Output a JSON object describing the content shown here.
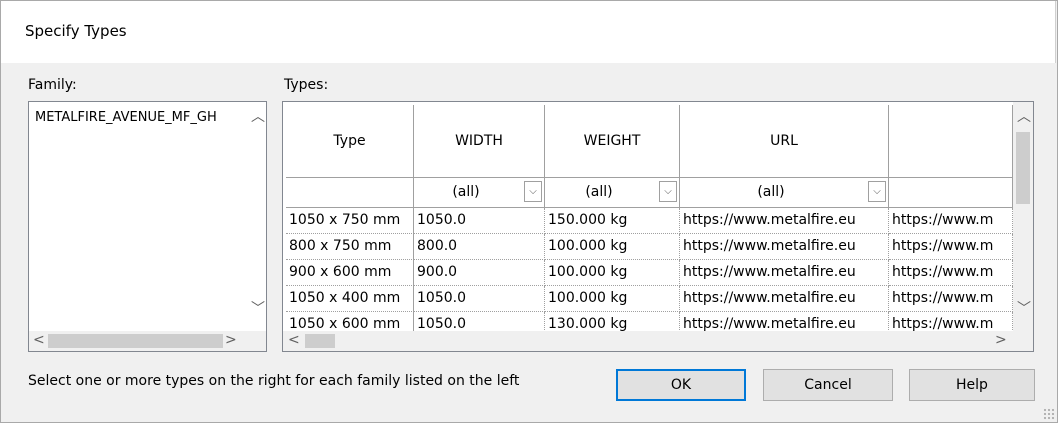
{
  "dialog": {
    "title": "Specify Types",
    "family_label": "Family:",
    "types_label": "Types:",
    "hint": "Select one or more types on the right for each family listed on the left"
  },
  "family": {
    "items": [
      "METALFIRE_AVENUE_MF_GH"
    ]
  },
  "types": {
    "columns": [
      "Type",
      "WIDTH",
      "WEIGHT",
      "URL",
      ""
    ],
    "filters": [
      "",
      "(all)",
      "(all)",
      "(all)",
      ""
    ],
    "rows": [
      [
        "1050 x 750 mm",
        "1050.0",
        "150.000 kg",
        "https://www.metalfire.eu",
        "https://www.m"
      ],
      [
        "800 x 750 mm",
        "800.0",
        "100.000 kg",
        "https://www.metalfire.eu",
        "https://www.m"
      ],
      [
        "900 x 600 mm",
        "900.0",
        "100.000 kg",
        "https://www.metalfire.eu",
        "https://www.m"
      ],
      [
        "1050 x 400 mm",
        "1050.0",
        "100.000 kg",
        "https://www.metalfire.eu",
        "https://www.m"
      ],
      [
        "1050 x 600 mm",
        "1050.0",
        "130.000 kg",
        "https://www.metalfire.eu",
        "https://www.m"
      ]
    ]
  },
  "buttons": {
    "ok": "OK",
    "cancel": "Cancel",
    "help": "Help"
  },
  "icons": {
    "up": "▲",
    "down": "▼",
    "left": "‹",
    "right": "›",
    "chevron_up": "⌃",
    "chevron_down": "⌄",
    "dropdown": "⌄"
  }
}
